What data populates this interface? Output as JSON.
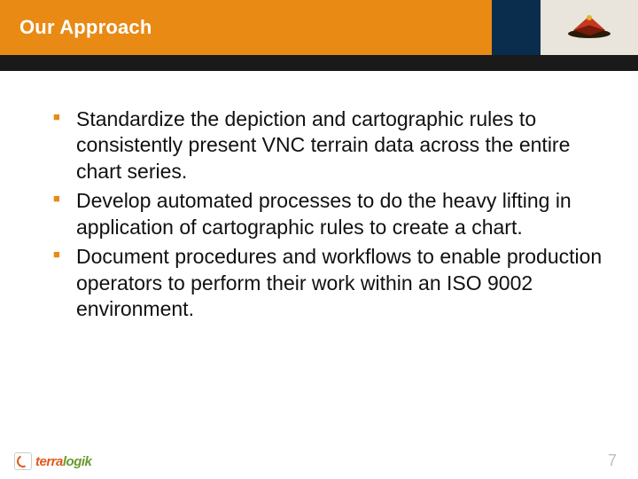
{
  "header": {
    "title": "Our Approach"
  },
  "bullets": [
    "Standardize the depiction and cartographic rules to consistently present VNC terrain data across the entire chart series.",
    "Develop automated processes to do the heavy lifting in application of cartographic rules to create a chart.",
    "Document procedures and workflows to enable production operators to perform their work within an ISO 9002 environment."
  ],
  "footer": {
    "brand_part1": "terra",
    "brand_part2": "logik",
    "page_number": "7"
  }
}
